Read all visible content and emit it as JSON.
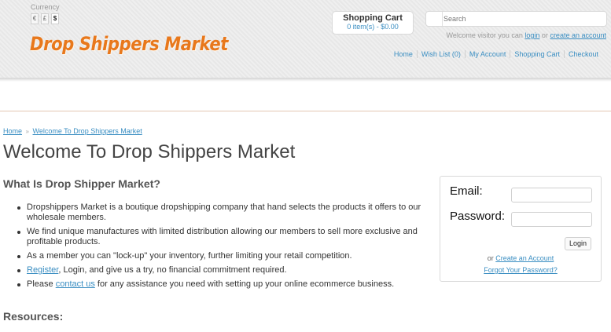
{
  "header": {
    "currency_label": "Currency",
    "currencies": [
      {
        "symbol": "€",
        "active": false
      },
      {
        "symbol": "£",
        "active": false
      },
      {
        "symbol": "$",
        "active": true
      }
    ],
    "logo_text": "Drop Shippers Market",
    "cart": {
      "title": "Shopping Cart",
      "summary": "0 item(s) - $0.00"
    },
    "search": {
      "placeholder": "Search"
    },
    "welcome": {
      "prefix": "Welcome visitor you can",
      "login": "login",
      "or": "or",
      "create": "create an account"
    },
    "nav": [
      {
        "label": "Home"
      },
      {
        "label": "Wish List (0)"
      },
      {
        "label": "My Account"
      },
      {
        "label": "Shopping Cart"
      },
      {
        "label": "Checkout"
      }
    ]
  },
  "breadcrumb": {
    "home": "Home",
    "separator": "»",
    "current": "Welcome To Drop Shippers Market"
  },
  "main": {
    "title": "Welcome To Drop Shippers Market",
    "section_title": "What Is Drop Shipper Market?",
    "bullets": {
      "b1": "Dropshippers Market is a boutique dropshipping company that hand selects the products it offers to our wholesale members.",
      "b2": "We find unique manufactures with limited distribution allowing our members to sell more exclusive and profitable products.",
      "b3": "As a member you can \"lock-up\" your inventory, further limiting your retail competition.",
      "b4_link": "Register",
      "b4_rest": ", Login, and give us a try, no financial commitment required.",
      "b5_pre": "Please ",
      "b5_link": "contact us",
      "b5_post": " for any assistance you need with setting up your online ecommerce business."
    },
    "resources_title": "Resources:"
  },
  "login": {
    "email_label": "Email:",
    "password_label": "Password:",
    "button": "Login",
    "or": "or",
    "create_link": "Create an Account",
    "forgot_link": "Forgot Your Password?"
  },
  "colors": {
    "logo": "#e8781c",
    "link": "#3a8ec2"
  }
}
